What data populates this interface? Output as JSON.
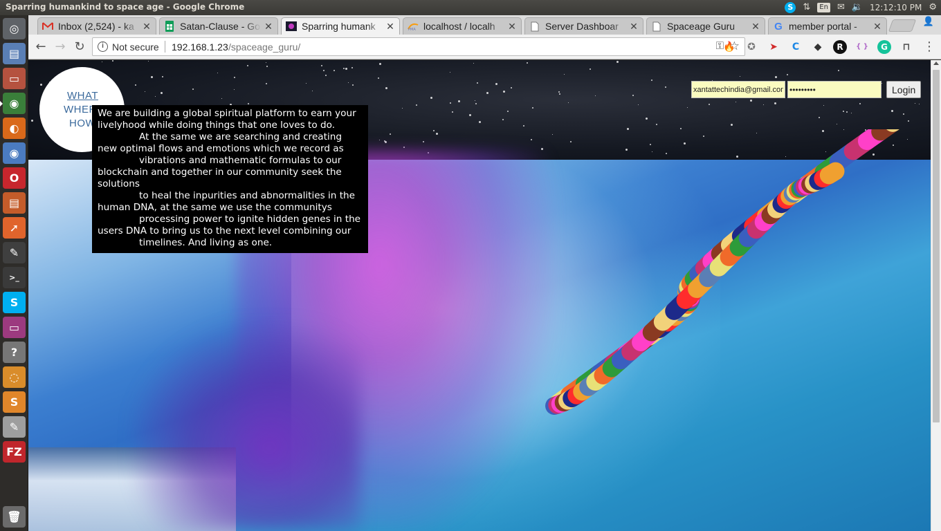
{
  "os_panel": {
    "window_title": "Sparring humankind to space age - Google Chrome",
    "clock": "12:12:10 PM",
    "keyboard_layout": "En",
    "tray_icons": [
      "skype-icon",
      "network-icon",
      "keyboard-icon",
      "mail-icon",
      "volume-icon",
      "gear-icon"
    ]
  },
  "launcher": {
    "items": [
      {
        "name": "dash-home",
        "icon": "ubuntu-logo-icon",
        "color": "#5f6368"
      },
      {
        "name": "files",
        "icon": "file-cabinet-icon",
        "color": "#5a7fb5"
      },
      {
        "name": "app-drawer",
        "icon": "window-icon",
        "color": "#b5523f"
      },
      {
        "name": "google-chrome",
        "icon": "chrome-icon",
        "color": "#3a7f3a"
      },
      {
        "name": "firefox",
        "icon": "firefox-icon",
        "color": "#d9691a"
      },
      {
        "name": "chromium",
        "icon": "chromium-icon",
        "color": "#4b7bc0"
      },
      {
        "name": "opera",
        "icon": "opera-icon",
        "color": "#c7262d"
      },
      {
        "name": "document-viewer",
        "icon": "document-icon",
        "color": "#c45c2a"
      },
      {
        "name": "postman",
        "icon": "rocket-icon",
        "color": "#e0642c"
      },
      {
        "name": "inkscape",
        "icon": "pen-icon",
        "color": "#3f3f3f"
      },
      {
        "name": "terminal",
        "icon": "terminal-icon",
        "color": "#3a3a3a"
      },
      {
        "name": "skype",
        "icon": "skype-icon",
        "color": "#00aff0"
      },
      {
        "name": "workspace",
        "icon": "window-icon",
        "color": "#9c3a7f"
      },
      {
        "name": "help",
        "icon": "question-icon",
        "color": "#777777"
      },
      {
        "name": "blender",
        "icon": "swirl-icon",
        "color": "#d98c2a"
      },
      {
        "name": "sublime-text",
        "icon": "sublime-icon",
        "color": "#e0862a"
      },
      {
        "name": "text-editor",
        "icon": "notepad-icon",
        "color": "#9e9e9e"
      },
      {
        "name": "filezilla",
        "icon": "filezilla-icon",
        "color": "#c0262c"
      },
      {
        "name": "trash",
        "icon": "trash-icon",
        "color": "#6b6b6b"
      }
    ],
    "fz_label": "FZ",
    "r_label": "R",
    "s_label": "S"
  },
  "tabs": [
    {
      "title": "Inbox (2,524) - ka",
      "favicon": "gmail-icon",
      "active": false
    },
    {
      "title": "Satan-Clause - Go",
      "favicon": "sheets-icon",
      "active": false
    },
    {
      "title": "Sparring humank",
      "favicon": "site-icon",
      "active": true
    },
    {
      "title": "localhost / localh",
      "favicon": "phpmyadmin-icon",
      "active": false
    },
    {
      "title": "Server Dashboar",
      "favicon": "page-icon",
      "active": false
    },
    {
      "title": "Spaceage Guru",
      "favicon": "page-icon",
      "active": false
    },
    {
      "title": "member portal -",
      "favicon": "google-icon",
      "active": false
    }
  ],
  "toolbar": {
    "security_label": "Not secure",
    "url_host": "192.168.1.23",
    "url_path": "/spaceage_guru/",
    "extensions": [
      "fire-icon",
      "compass-icon",
      "red-bird-icon",
      "c-icon",
      "ninja-icon",
      "r-icon",
      "json-icon",
      "grammarly-icon",
      "bookmark-icon"
    ]
  },
  "page": {
    "nav": {
      "what": "WHAT",
      "where": "WHERE",
      "how": "HOW"
    },
    "description": {
      "line1": "We are building a global spiritual platform to earn your livelyhood while doing things that one loves to do.",
      "line2": "At the same we are searching and creating new optimal flows and emotions which we record as",
      "line3": "vibrations and mathematic formulas to our blockchain and together in our community seek the solutions",
      "line4": "to heal the inpurities and abnormalities in the human DNA, at the same we use the communitys",
      "line5": "processing power to ignite hidden genes in the users DNA to bring us to the next level combining our",
      "line6": "timelines. And living as one."
    },
    "login": {
      "email_value": "xantattechindia@gmail.com",
      "password_value": "•••••••••",
      "button_label": "Login"
    }
  },
  "colors": {
    "accent_link": "#3b6a9c",
    "autofill_bg": "#fafbc0",
    "desc_bg": "#000000"
  }
}
